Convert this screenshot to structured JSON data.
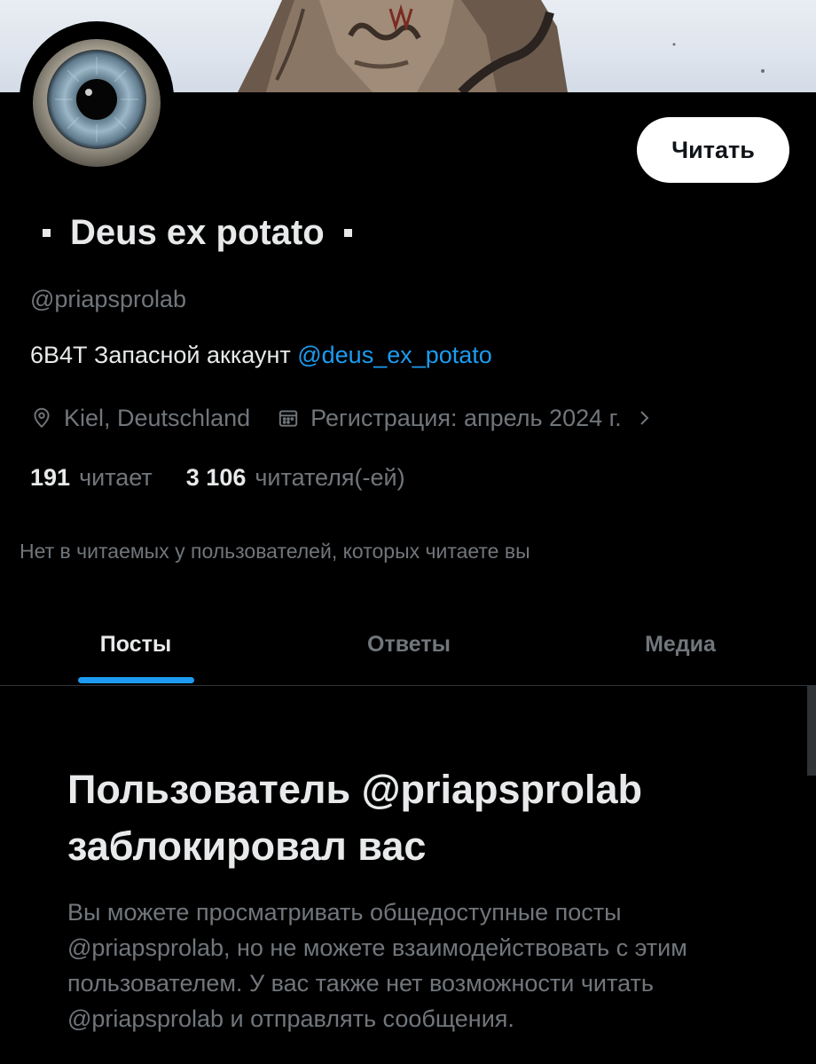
{
  "profile": {
    "display_name": "Deus ex potato",
    "handle": "@priapsprolab",
    "follow_button": "Читать",
    "bio_text": "6В4Т  Запасной аккаунт ",
    "bio_mention": "@deus_ex_potato",
    "location": "Kiel, Deutschland",
    "joined": "Регистрация: апрель 2024 г.",
    "following_count": "191",
    "following_label": "читает",
    "followers_count": "3 106",
    "followers_label": "читателя(-ей)",
    "followed_by_note": "Нет в читаемых у пользователей, которых читаете вы"
  },
  "tabs": [
    {
      "label": "Посты",
      "active": true
    },
    {
      "label": "Ответы",
      "active": false
    },
    {
      "label": "Медиа",
      "active": false
    }
  ],
  "blocked": {
    "title": "Пользователь @priapsprolab заблокировал вас",
    "description": "Вы можете просматривать общедоступные посты @priapsprolab, но не можете взаимодействовать с этим пользователем. У вас также нет возможности читать @priapsprolab и отправлять сообщения."
  },
  "icons": {
    "location": "location-pin-icon",
    "calendar": "calendar-icon",
    "chevron": "chevron-right-icon"
  },
  "colors": {
    "accent": "#1d9bf0",
    "background": "#000000",
    "text_primary": "#e7e9ea",
    "text_secondary": "#71767b"
  }
}
